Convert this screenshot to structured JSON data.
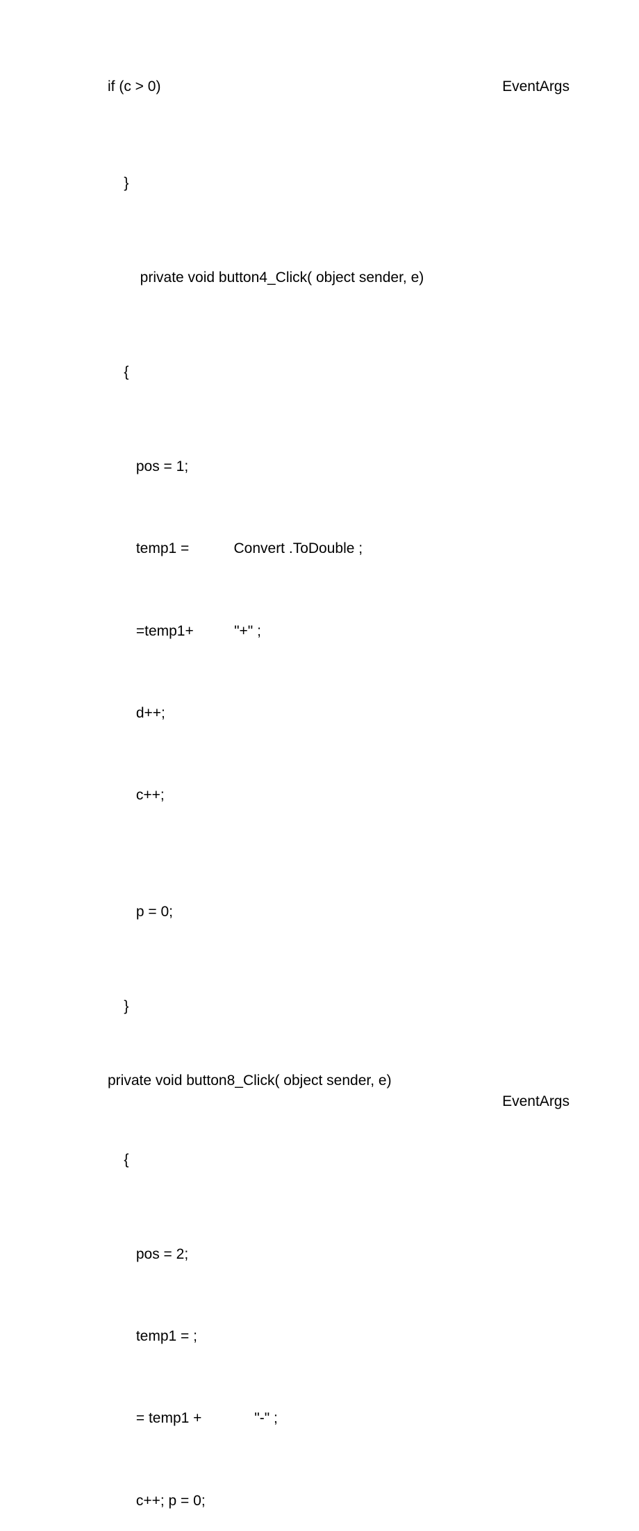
{
  "lines": {
    "l1_left": "         if (c > 0)",
    "l1_right": "EventArgs",
    "l2": "}",
    "l3": "    private void button4_Click( object sender, e)",
    "l4": "{",
    "l5": "   pos = 1;",
    "l6": "   temp1 =           Convert .ToDouble ;",
    "l7": "   =temp1+          \"+\" ;",
    "l8": "   d++;",
    "l9": "   c++;",
    "l10": "   p = 0;",
    "l11": "}",
    "l12": "    private void button8_Click( object sender, e)",
    "l12_right": "EventArgs",
    "l13": "{",
    "l14": "   pos = 2;",
    "l15": "   temp1 = ;",
    "l16": "   = temp1 +             \"-\" ;",
    "l17": "   c++; p = 0;"
  }
}
